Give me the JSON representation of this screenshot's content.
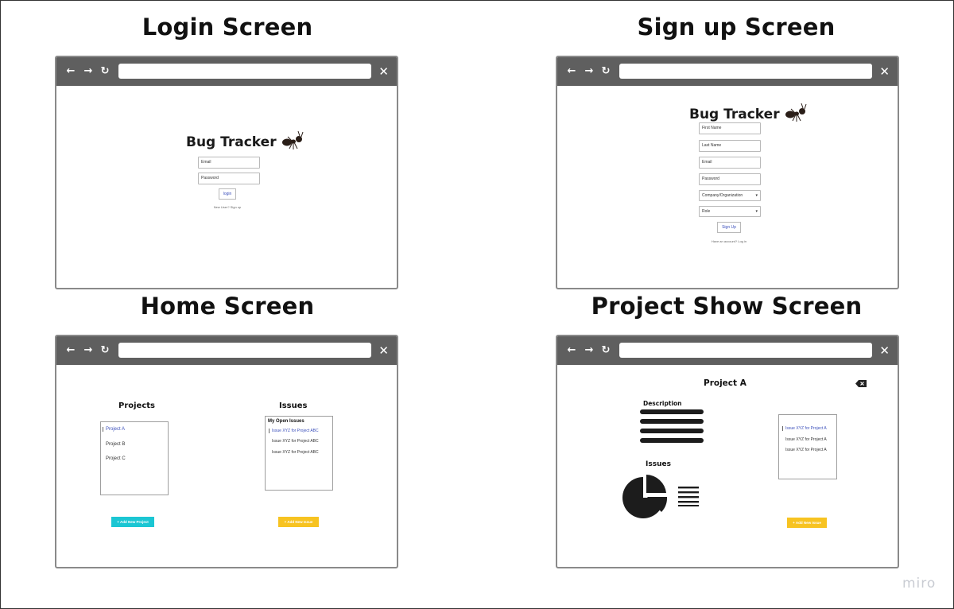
{
  "screens": {
    "login": {
      "title": "Login Screen",
      "brand": "Bug Tracker",
      "email_placeholder": "Email",
      "password_placeholder": "Password",
      "login_label": "login",
      "signup_link": "New User? Sign up"
    },
    "signup": {
      "title": "Sign up Screen",
      "brand": "Bug Tracker",
      "first_name": "First Name",
      "last_name": "Last Name",
      "email": "Email",
      "password": "Password",
      "company": "Company/Organization",
      "role": "Role",
      "signup_label": "Sign Up",
      "login_link": "Have an account? Log in"
    },
    "home": {
      "title": "Home Screen",
      "projects_heading": "Projects",
      "projects": [
        "Project A",
        "Project B",
        "Project C"
      ],
      "issues_heading": "Issues",
      "open_issues_heading": "My Open Issues",
      "issues": [
        "Issue XYZ for Project ABC",
        "Issue XYZ for Project ABC",
        "Issue XYZ for Project ABC"
      ],
      "add_project_label": "Add New Project",
      "add_issue_label": "Add New Issue"
    },
    "project_show": {
      "title": "Project Show Screen",
      "project_name": "Project A",
      "description_heading": "Description",
      "issues_heading": "Issues",
      "issues": [
        "Issue XYZ for Project A",
        "Issue XYZ for Project A",
        "Issue XYZ for Project A"
      ],
      "add_issue_label": "Add New Issue"
    }
  },
  "browser": {
    "back": "←",
    "forward": "→",
    "reload": "↻",
    "close": "✕"
  },
  "icons": {
    "ant": "ant-icon",
    "delete": "delete-icon",
    "pie": "pie-chart-icon",
    "list": "list-icon"
  },
  "colors": {
    "bar": "#5f5f5f",
    "teal": "#1bc6d3",
    "yellow": "#f7c321",
    "link": "#3b4fbb"
  },
  "watermark": "miro"
}
